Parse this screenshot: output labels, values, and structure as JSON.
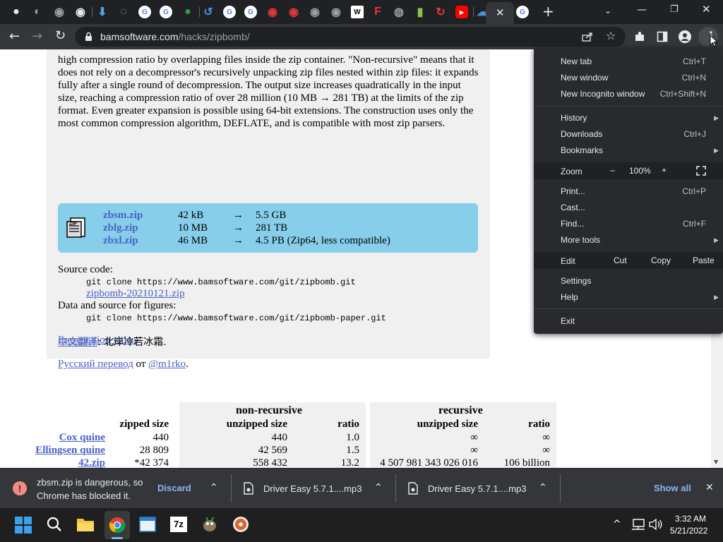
{
  "browser": {
    "url_host": "bamsoftware.com",
    "url_path": "/hacks/zipbomb/",
    "new_tab_glyph": "+"
  },
  "tabs": [
    {
      "icon": "github-icon",
      "color": "#e8eaed"
    },
    {
      "icon": "chromium-icon",
      "color": "#9aa0a6"
    },
    {
      "icon": "chrome-icon",
      "color": "#9aa0a6"
    },
    {
      "icon": "chrome-icon",
      "color": "#e8eaed"
    },
    {
      "icon": "arrow-down-icon",
      "color": "#4fa3e0"
    },
    {
      "icon": "edge-icon",
      "color": "#3ccbd1"
    },
    {
      "icon": "google-icon",
      "color": "#ffffff"
    },
    {
      "icon": "google-icon",
      "color": "#ffffff"
    },
    {
      "icon": "green-circle-icon",
      "color": "#2ea043"
    },
    {
      "icon": "history-icon",
      "color": "#4a8fe0"
    },
    {
      "icon": "google-icon",
      "color": "#ffffff"
    },
    {
      "icon": "google-icon",
      "color": "#ffffff"
    },
    {
      "icon": "red-app-icon",
      "color": "#e53935"
    },
    {
      "icon": "red-app-icon",
      "color": "#e53935"
    },
    {
      "icon": "chrome-icon",
      "color": "#9aa0a6"
    },
    {
      "icon": "chrome-icon",
      "color": "#9aa0a6"
    },
    {
      "icon": "wikipedia-icon",
      "color": "#ffffff"
    },
    {
      "icon": "flipboard-icon",
      "color": "#e53935"
    },
    {
      "icon": "globe-icon",
      "color": "#9aa0a6"
    },
    {
      "icon": "battery-icon",
      "color": "#8bc34a"
    },
    {
      "icon": "sync-icon",
      "color": "#e53935"
    },
    {
      "icon": "youtube-icon",
      "color": "#ff0000"
    },
    {
      "icon": "cloud-download-icon",
      "color": "#4a8fe0"
    },
    {
      "icon": "google-icon",
      "color": "#ffffff"
    }
  ],
  "article": {
    "intro": "high compression ratio by overlapping files inside the zip container. \"Non-recursive\" means that it does not rely on a decompressor's recursively unpacking zip files nested within zip files: it expands fully after a single round of decompression. The output size increases quadratically in the input size, reaching a compression ratio of over 28 million (10 MB → 281 TB) at the limits of the zip format. Even greater expansion is possible using 64-bit extensions. The construction uses only the most common compression algorithm, DEFLATE, and is compatible with most zip parsers.",
    "downloads": [
      {
        "name": "zbsm.zip",
        "size": "42 kB",
        "arrow": "→",
        "result": "5.5 GB"
      },
      {
        "name": "zblg.zip",
        "size": "10 MB",
        "arrow": "→",
        "result": "281 TB"
      },
      {
        "name": "zbxl.zip",
        "size": "46 MB",
        "arrow": "→",
        "result": "4.5 PB (Zip64, less compatible)"
      }
    ],
    "source_label": "Source code:",
    "source_cmd": "git clone https://www.bamsoftware.com/git/zipbomb.git",
    "source_zip": "zipbomb-20210121.zip",
    "data_label": "Data and source for figures:",
    "data_cmd": "git clone https://www.bamsoftware.com/git/zipbomb-paper.git",
    "video_link": "Presentation video",
    "russian_link": "Русский перевод",
    "russian_ot": " от ",
    "russian_author": "@m1rko",
    "russian_end": ".",
    "chinese_link": "中文翻译",
    "chinese_rest": ": 北岸冷若冰霜."
  },
  "stats": {
    "group_nonrec": "non-recursive",
    "group_rec": "recursive",
    "col_zipped": "zipped size",
    "col_unzipped1": "unzipped size",
    "col_ratio1": "ratio",
    "col_unzipped2": "unzipped size",
    "col_ratio2": "ratio",
    "rows": [
      {
        "name": "Cox quine",
        "zipped": "440",
        "unzipped": "440",
        "ratio": "1.0",
        "rec_unzipped": "∞",
        "rec_ratio": "∞"
      },
      {
        "name": "Ellingsen quine",
        "zipped": "28 809",
        "unzipped": "42 569",
        "ratio": "1.5",
        "rec_unzipped": "∞",
        "rec_ratio": "∞"
      },
      {
        "name": "42.zip",
        "zipped": "*42 374",
        "unzipped": "558 432",
        "ratio": "13.2",
        "rec_unzipped": "4 507 981 343 026 016",
        "rec_ratio": "106 billion"
      }
    ]
  },
  "menu": {
    "new_tab": "New tab",
    "new_tab_sc": "Ctrl+T",
    "new_window": "New window",
    "new_window_sc": "Ctrl+N",
    "new_incognito": "New Incognito window",
    "new_incognito_sc": "Ctrl+Shift+N",
    "history": "History",
    "downloads": "Downloads",
    "downloads_sc": "Ctrl+J",
    "bookmarks": "Bookmarks",
    "zoom": "Zoom",
    "zoom_minus": "−",
    "zoom_value": "100%",
    "zoom_plus": "+",
    "print": "Print...",
    "print_sc": "Ctrl+P",
    "cast": "Cast...",
    "find": "Find...",
    "find_sc": "Ctrl+F",
    "more_tools": "More tools",
    "edit": "Edit",
    "cut": "Cut",
    "copy": "Copy",
    "paste": "Paste",
    "settings": "Settings",
    "help": "Help",
    "exit": "Exit"
  },
  "download_bar": {
    "warning": "zbsm.zip is dangerous, so Chrome has blocked it.",
    "discard": "Discard",
    "item1": "Driver Easy 5.7.1....mp3",
    "item2": "Driver Easy 5.7.1....mp3",
    "show_all": "Show all"
  },
  "taskbar": {
    "time": "3:32 AM",
    "date": "5/21/2022",
    "zip_label": "7z"
  },
  "colors": {
    "chrome_dark": "#202124",
    "toolbar": "#35363a",
    "link": "#4a62c4",
    "download_box": "#87ceeb",
    "discard_blue": "#8ab4f8",
    "danger_red": "#f28b82"
  }
}
